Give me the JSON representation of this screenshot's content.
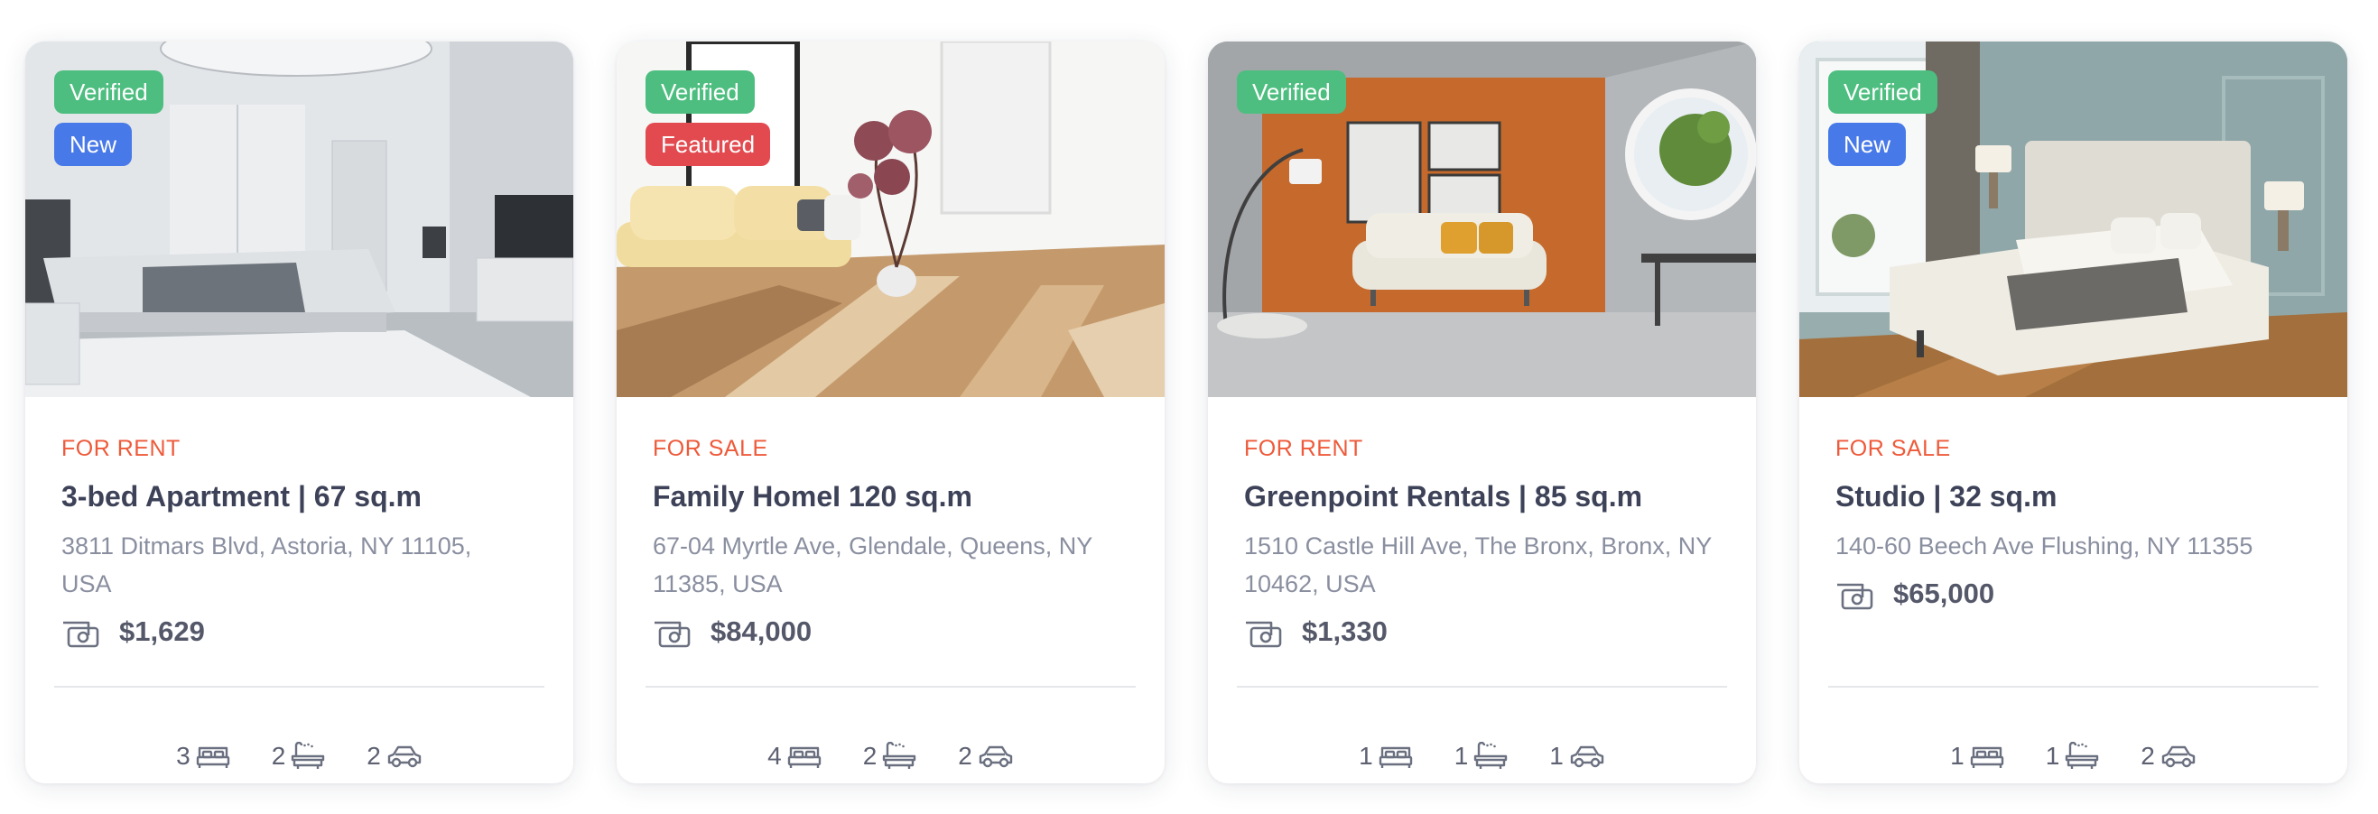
{
  "colors": {
    "verified": "#4dbe7f",
    "new": "#4879e8",
    "featured": "#e24a4f",
    "listing_type": "#ee5a3a",
    "title": "#3d4258",
    "address": "#8a8fa0"
  },
  "listings": [
    {
      "photo": "modern-bedroom-photo",
      "badges": [
        {
          "label": "Verified",
          "kind": "verified"
        },
        {
          "label": "New",
          "kind": "new"
        }
      ],
      "type": "FOR RENT",
      "title": "3-bed Apartment | 67 sq.m",
      "address": "3811 Ditmars Blvd, Astoria, NY 11105, USA",
      "price": "$1,629",
      "features": {
        "bedrooms": "3",
        "bathrooms": "2",
        "garages": "2"
      }
    },
    {
      "photo": "living-room-sofa-photo",
      "badges": [
        {
          "label": "Verified",
          "kind": "verified"
        },
        {
          "label": "Featured",
          "kind": "featured"
        }
      ],
      "type": "FOR SALE",
      "title": "Family HomeI 120 sq.m",
      "address": "67-04 Myrtle Ave, Glendale, Queens, NY 11385, USA",
      "price": "$84,000",
      "features": {
        "bedrooms": "4",
        "bathrooms": "2",
        "garages": "2"
      }
    },
    {
      "photo": "orange-wall-living-room-photo",
      "badges": [
        {
          "label": "Verified",
          "kind": "verified"
        }
      ],
      "type": "FOR RENT",
      "title": "Greenpoint Rentals | 85 sq.m",
      "address": "1510 Castle Hill Ave, The Bronx, Bronx, NY 10462, USA",
      "price": "$1,330",
      "features": {
        "bedrooms": "1",
        "bathrooms": "1",
        "garages": "1"
      }
    },
    {
      "photo": "teal-bedroom-photo",
      "badges": [
        {
          "label": "Verified",
          "kind": "verified"
        },
        {
          "label": "New",
          "kind": "new"
        }
      ],
      "type": "FOR SALE",
      "title": "Studio | 32 sq.m",
      "address": "140-60 Beech Ave Flushing, NY 11355",
      "price": "$65,000",
      "features": {
        "bedrooms": "1",
        "bathrooms": "1",
        "garages": "2"
      }
    }
  ],
  "icons": {
    "price": "money-icon",
    "bedrooms": "bed-icon",
    "bathrooms": "bathtub-icon",
    "garages": "car-icon"
  }
}
